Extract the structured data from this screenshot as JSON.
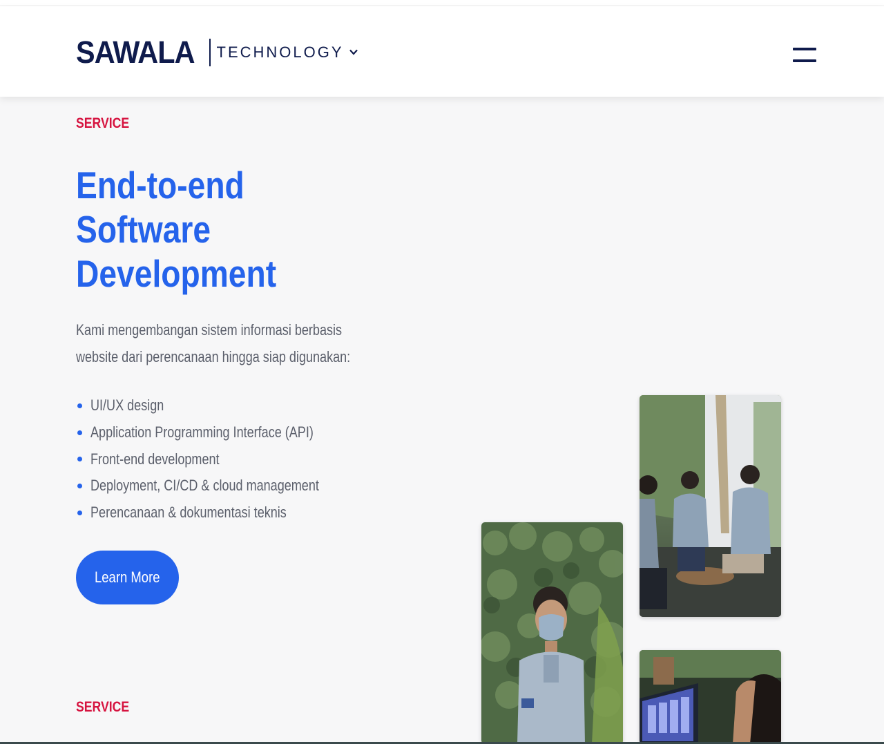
{
  "header": {
    "brand": "SAWALA",
    "division": "TECHNOLOGY",
    "division_dropdown_icon": "chevron-down-icon",
    "menu_icon": "hamburger-menu-icon"
  },
  "service": {
    "eyebrow": "SERVICE",
    "title_lines": [
      "End-to-end",
      "Software",
      "Development"
    ],
    "description_lines": [
      "Kami mengembangan sistem informasi berbasis",
      "website dari perencanaan hingga siap digunakan:"
    ],
    "features": [
      "UI/UX design",
      "Application Programming Interface (API)",
      "Front-end development",
      "Deployment, CI/CD & cloud management",
      "Perencanaan & dokumentasi teknis"
    ],
    "cta_label": "Learn More"
  },
  "next_section": {
    "eyebrow": "SERVICE"
  },
  "colors": {
    "brand_navy": "#0f1b4c",
    "accent_blue": "#2563eb",
    "eyebrow_red": "#d6133f",
    "body_text": "#5b5f6b",
    "background": "#f7f7f8"
  }
}
